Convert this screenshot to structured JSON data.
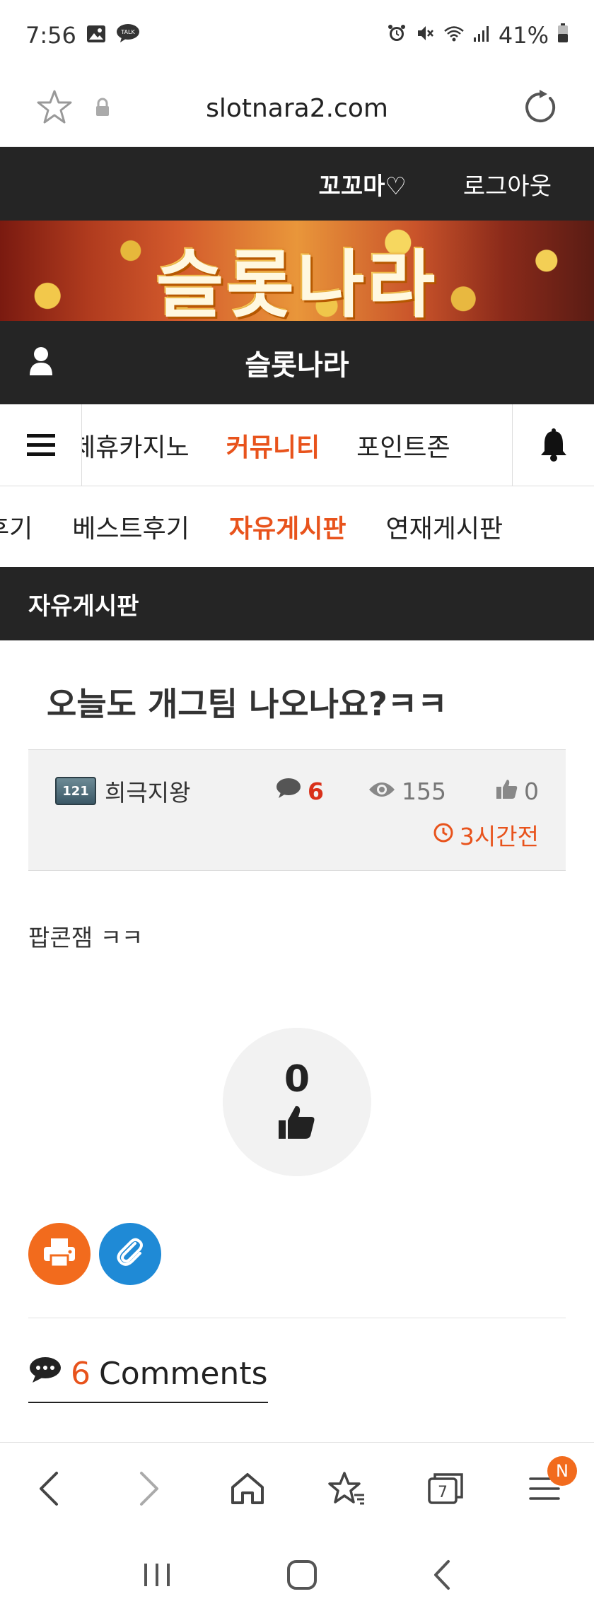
{
  "status_bar": {
    "time": "7:56",
    "battery": "41%"
  },
  "browser": {
    "url": "slotnara2.com"
  },
  "site_top": {
    "user_name": "꼬꼬마♡",
    "logout_label": "로그아웃"
  },
  "banner": {
    "title": "슬롯나라"
  },
  "site_bar": {
    "name": "슬롯나라"
  },
  "main_menu": {
    "items": [
      "제휴카지노",
      "커뮤니티",
      "포인트존"
    ],
    "active_index": 1
  },
  "sub_menu": {
    "items": [
      "후기",
      "베스트후기",
      "자유게시판",
      "연재게시판"
    ],
    "active_index": 2
  },
  "board": {
    "title": "자유게시판"
  },
  "post": {
    "title": "오늘도 개그팀 나오나요?ㅋㅋ",
    "level_badge": "121",
    "author": "희극지왕",
    "comment_count": "6",
    "views": "155",
    "likes": "0",
    "time_ago": "3시간전",
    "body": "팝콘잼 ㅋㅋ",
    "recommend_count": "0"
  },
  "comments": {
    "count": "6",
    "label": "Comments"
  },
  "browser_nav": {
    "tabs_count": "7",
    "menu_badge": "N"
  },
  "colors": {
    "accent": "#e8531c",
    "dark_bar": "#252525",
    "comment_red": "#d9311a",
    "print_btn": "#f26b1d",
    "link_btn": "#1f8ad6"
  }
}
